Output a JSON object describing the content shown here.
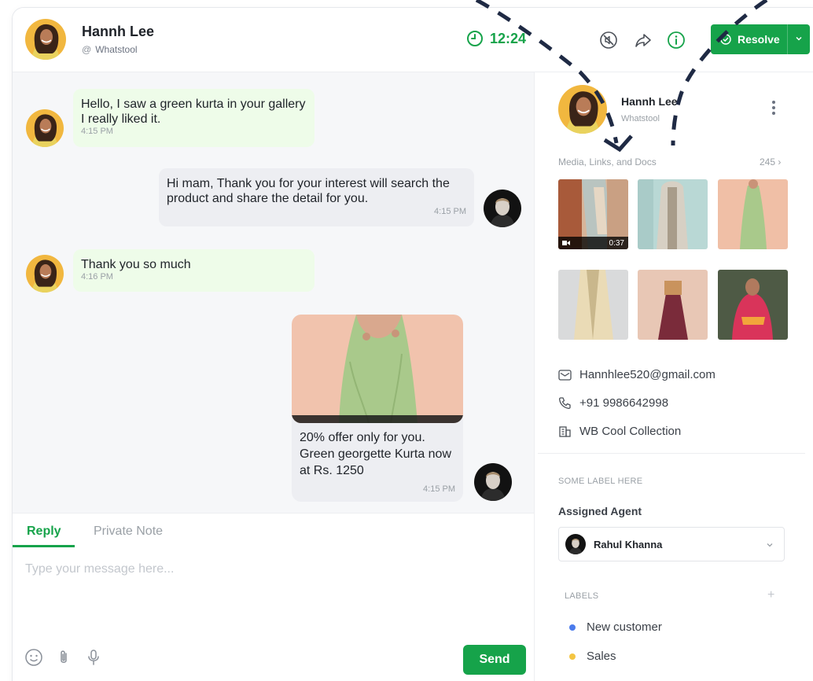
{
  "header": {
    "contact_name": "Hannh Lee",
    "contact_channel": "Whatstool",
    "channel_prefix": "@",
    "timer": "12:24",
    "resolve_label": "Resolve"
  },
  "messages": [
    {
      "direction": "incoming",
      "text": "Hello, I saw a green kurta in your gallery I really liked it.",
      "time": "4:15 PM"
    },
    {
      "direction": "outgoing",
      "text": "Hi mam, Thank you for your interest will search the product and share the detail for you.",
      "time": "4:15 PM"
    },
    {
      "direction": "incoming",
      "text": "Thank you so much",
      "time": "4:16 PM"
    },
    {
      "direction": "outgoing",
      "type": "image",
      "caption": "20% offer only for you. Green georgette Kurta now at Rs. 1250",
      "time": "4:15 PM"
    }
  ],
  "composer": {
    "tab_reply": "Reply",
    "tab_private_note": "Private Note",
    "placeholder": "Type your message here...",
    "value": "",
    "send_label": "Send"
  },
  "panel": {
    "name": "Hannh Lee",
    "channel": "Whatstool",
    "media_title": "Media, Links, and Docs",
    "media_count": "245 ›",
    "video_duration": "0:37",
    "email": "Hannhlee520@gmail.com",
    "phone": "+91 9986642998",
    "company": "WB Cool Collection",
    "section_label": "SOME LABEL HERE",
    "assigned_agent_title": "Assigned Agent",
    "agent_name": "Rahul Khanna",
    "labels_title": "LABELS",
    "labels": [
      {
        "name": "New customer",
        "color": "#4b7bec"
      },
      {
        "name": "Sales",
        "color": "#f4c542"
      }
    ]
  },
  "colors": {
    "accent": "#16a34a",
    "incoming_bubble": "#eefce9",
    "outgoing_bubble": "#edeef2"
  },
  "icons": [
    "clock-icon",
    "mute-icon",
    "share-icon",
    "info-icon",
    "check-circle-icon",
    "chevron-down-icon",
    "more-vertical-icon",
    "mail-icon",
    "phone-icon",
    "building-icon",
    "emoji-icon",
    "paperclip-icon",
    "microphone-icon",
    "plus-icon",
    "video-icon"
  ]
}
